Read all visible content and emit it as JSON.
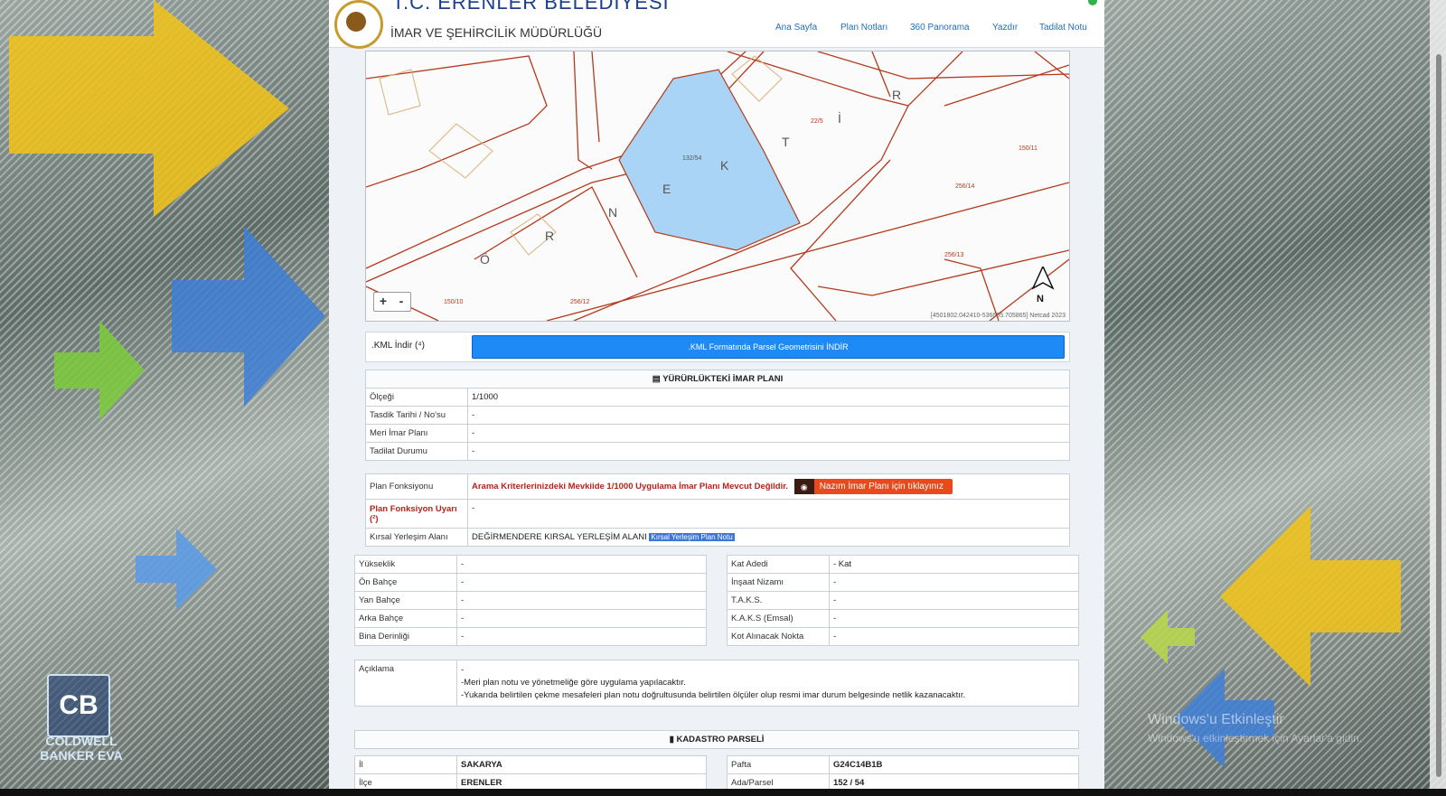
{
  "header": {
    "title": "T.C. ERENLER BELEDİYESİ",
    "subtitle": "İMAR VE ŞEHİRCİLİK MÜDÜRLÜĞÜ",
    "nav": [
      "Ana Sayfa",
      "Plan Notları",
      "360 Panorama",
      "Yazdır",
      "Tadilat Notu"
    ]
  },
  "map": {
    "parcel_label": "132/54",
    "labels": [
      "22/5",
      "150/11",
      "256/14",
      "256/13",
      "150/10",
      "256/12"
    ],
    "road_letters": [
      "Ö",
      "R",
      "N",
      "E",
      "K",
      "T",
      "İ",
      "R"
    ],
    "zoom_in": "+",
    "zoom_out": "-",
    "north": "N",
    "coords": "[4501802.042410-536605.705865] Netcad 2023"
  },
  "kml": {
    "label": ".KML İndir (⁴)",
    "button": ".KML Formatında Parsel Geometrisini İNDİR"
  },
  "plan": {
    "heading": "YÜRÜRLÜKTEKİ İMAR PLANI",
    "rows": [
      {
        "label": "Ölçeği",
        "value": "1/1000"
      },
      {
        "label": "Tasdik Tarihi / No'su",
        "value": "-"
      },
      {
        "label": "Meri İmar Planı",
        "value": "-"
      },
      {
        "label": "Tadilat Durumu",
        "value": "-"
      }
    ]
  },
  "function": {
    "label": "Plan Fonksiyonu",
    "value": "Arama Kriterlerinizdeki Mevkiide 1/1000 Uygulama İmar Planı Mevcut Değildir.",
    "button": "Nazım İmar Planı için tıklayınız",
    "warning_label": "Plan Fonksiyon Uyarı (²)",
    "warning_value": "-",
    "rural_label": "Kırsal Yerleşim Alanı",
    "rural_value": "DEĞİRMENDERE KIRSAL YERLEŞİM ALANI",
    "rural_link": "Kırsal Yerleşim Plan Notu"
  },
  "building_left": [
    {
      "label": "Yükseklik",
      "value": "-"
    },
    {
      "label": "Ön Bahçe",
      "value": "-"
    },
    {
      "label": "Yan Bahçe",
      "value": "-"
    },
    {
      "label": "Arka Bahçe",
      "value": "-"
    },
    {
      "label": "Bina Derinliği",
      "value": "-"
    }
  ],
  "building_right": [
    {
      "label": "Kat Adedi",
      "value": "- Kat"
    },
    {
      "label": "İnşaat Nizamı",
      "value": "-"
    },
    {
      "label": "T.A.K.S.",
      "value": "-"
    },
    {
      "label": "K.A.K.S (Emsal)",
      "value": "-"
    },
    {
      "label": "Kot Alınacak Nokta",
      "value": "-"
    }
  ],
  "description": {
    "label": "Açıklama",
    "lines": [
      "-",
      "-Meri plan notu ve yönetmeliğe göre uygulama yapılacaktır.",
      "-Yukarıda belirtilen çekme mesafeleri plan notu doğrultusunda belirtilen ölçüler olup resmi imar durum belgesinde netlik kazanacaktır."
    ]
  },
  "kadastro": {
    "heading": "KADASTRO PARSELİ",
    "left": [
      {
        "label": "İl",
        "value": "SAKARYA"
      },
      {
        "label": "İlçe",
        "value": "ERENLER"
      }
    ],
    "right": [
      {
        "label": "Pafta",
        "value": "G24C14B1B"
      },
      {
        "label": "Ada/Parsel",
        "value": "152 / 54"
      }
    ]
  },
  "overlay": {
    "cb_mark": "CB",
    "cb_text": "COLDWELL BANKER EVA",
    "windows_line1": "Windows'u Etkinleştir",
    "windows_line2": "Windows'u etkinleştirmek için Ayarlar'a gidin."
  },
  "colors": {
    "accent": "#1e8af6",
    "parcel_fill": "#a9d4f5",
    "parcel_line": "#b33a1c",
    "button_red": "#e84a1c"
  }
}
